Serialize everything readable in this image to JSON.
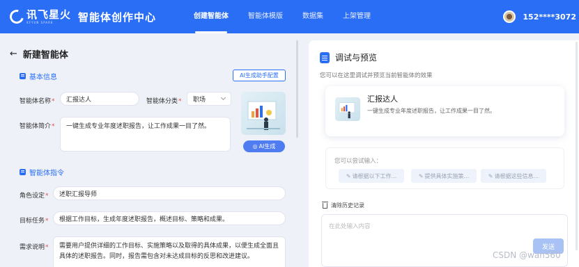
{
  "header": {
    "logo_text": "讯飞星火",
    "logo_sub": "XFYUN SPARK",
    "brand_title": "智能体创作中心",
    "nav": [
      {
        "label": "创建智能体",
        "active": true
      },
      {
        "label": "智能体模版",
        "active": false
      },
      {
        "label": "数据集",
        "active": false
      },
      {
        "label": "上架管理",
        "active": false
      }
    ],
    "username": "152****3072"
  },
  "left": {
    "page_title": "新建智能体",
    "basic_info_title": "基本信息",
    "ai_config_label": "AI生成助手配置",
    "name_label": "智能体名称",
    "name_value": "汇报达人",
    "category_label": "智能体分类",
    "category_value": "职场",
    "intro_label": "智能体简介",
    "intro_value": "一键生成专业年度述职报告，让工作成果一目了然。",
    "ai_generate_label": "AI生成",
    "instruction_title": "智能体指令",
    "role_label": "角色设定",
    "role_value": "述职汇报导师",
    "goal_label": "目标任务",
    "goal_value": "根据工作目标，生成年度述职报告，概述目标、策略和成果。",
    "needs_label": "需求说明",
    "needs_value": "需要用户提供详细的工作目标、实施策略以及取得的具体成果，以便生成全面且具体的述职报告。同时，报告需包含对未达成目标的反思和改进建议。"
  },
  "right": {
    "title": "调试与预览",
    "subtitle": "您可以在这里调试并预览当前智能体的效果",
    "card_name": "汇报达人",
    "card_desc": "一键生成专业年度述职报告，让工作成果一目了然。",
    "suggest_label": "您可以尝试输入：",
    "chips": [
      "请根据以下工作...",
      "提供具体实施策...",
      "请根据这些信息..."
    ],
    "clear_label": "清除历史记录",
    "input_placeholder": "在此处输入内容",
    "send_label": "发送"
  },
  "watermark": "CSDN @wan560",
  "colors": {
    "primary": "#2b6ef6",
    "required": "#e34d4d",
    "send_disabled": "#a9c2f6"
  }
}
